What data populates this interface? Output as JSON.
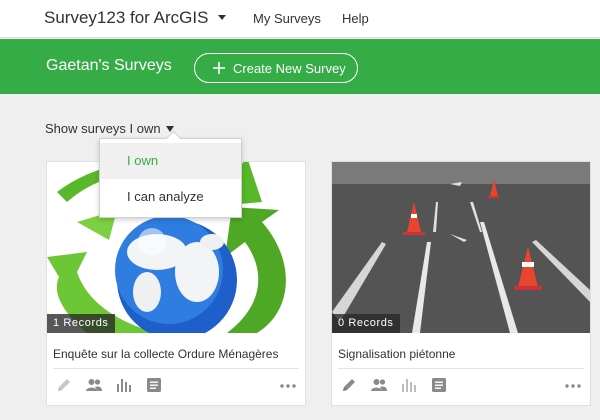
{
  "topnav": {
    "app_title": "Survey123 for ArcGIS",
    "links": [
      "My Surveys",
      "Help"
    ]
  },
  "banner": {
    "title": "Gaetan's Surveys",
    "create_button": "Create New Survey"
  },
  "filter": {
    "label": "Show surveys I own",
    "options": [
      "I own",
      "I can analyze"
    ],
    "selected": "I own"
  },
  "cards": [
    {
      "records": "1 Records",
      "title": "Enquête sur la collecte Ordure Ménagères"
    },
    {
      "records": "0 Records",
      "title": "Signalisation piétonne"
    }
  ],
  "colors": {
    "brand_green": "#35ac46",
    "icon_gray": "#8a8a8a"
  },
  "icons": [
    "pencil-icon",
    "people-icon",
    "bar-chart-icon",
    "document-icon",
    "more-icon"
  ]
}
